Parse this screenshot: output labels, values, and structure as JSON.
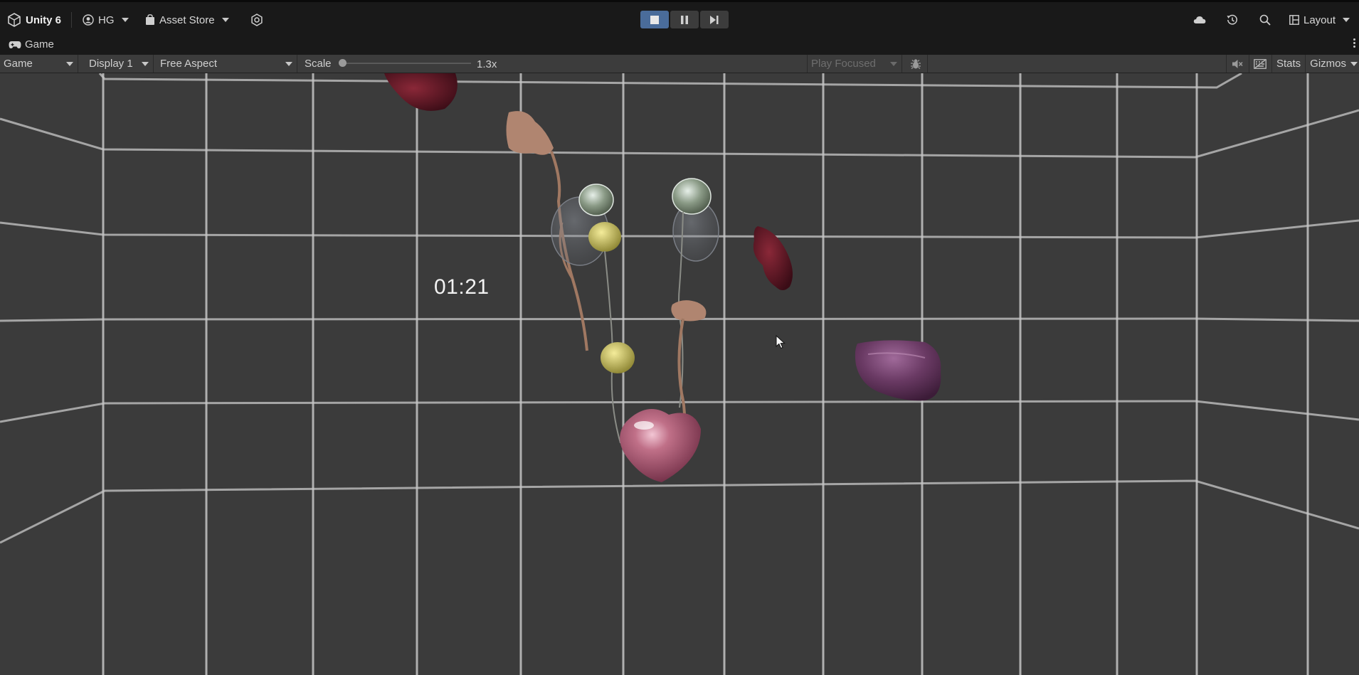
{
  "app": {
    "name": "Unity 6",
    "account": "HG",
    "asset_store": "Asset Store",
    "layout": "Layout"
  },
  "play_controls": {
    "stop": "stop-icon",
    "pause": "pause-icon",
    "step": "step-icon",
    "playing": true
  },
  "tab": {
    "label": "Game"
  },
  "game_toolbar": {
    "mode": "Game",
    "display": "Display 1",
    "aspect": "Free Aspect",
    "scale_label": "Scale",
    "scale_value": "1.3x",
    "play_mode": "Play Focused",
    "stats": "Stats",
    "gizmos": "Gizmos"
  },
  "game_view": {
    "timer": "01:21"
  },
  "colors": {
    "accent_play": "#4a6c9a",
    "background": "#191919",
    "toolbar": "#3c3c3c",
    "viewport": "#3b3b3b"
  }
}
